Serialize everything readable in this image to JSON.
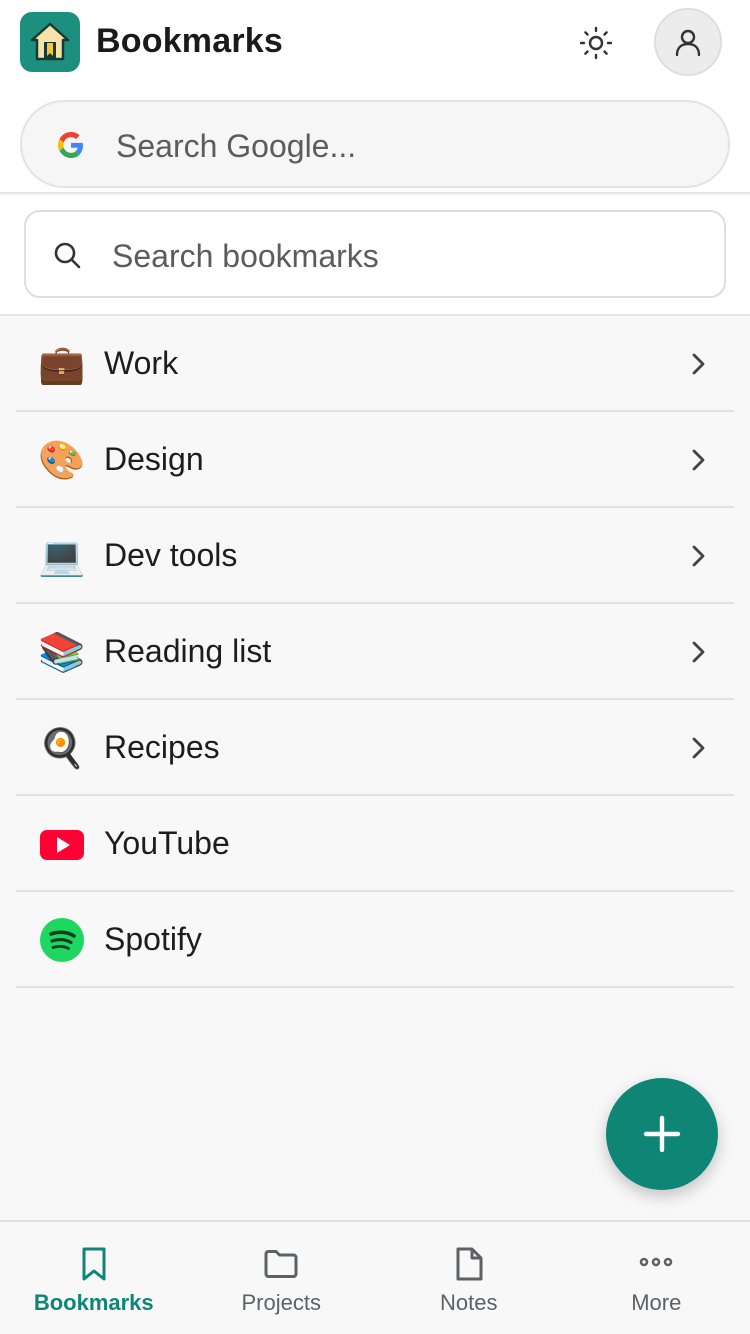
{
  "header": {
    "title": "Bookmarks",
    "logo_icon": "house-bookmark-icon",
    "theme_icon": "sun-icon",
    "avatar_icon": "user-icon"
  },
  "google_search": {
    "placeholder": "Search Google..."
  },
  "bookmark_search": {
    "placeholder": "Search bookmarks"
  },
  "items": [
    {
      "label": "Work",
      "icon": "briefcase-emoji",
      "emoji": "💼",
      "has_chevron": true
    },
    {
      "label": "Design",
      "icon": "palette-emoji",
      "emoji": "🎨",
      "has_chevron": true
    },
    {
      "label": "Dev tools",
      "icon": "laptop-emoji",
      "emoji": "💻",
      "has_chevron": true
    },
    {
      "label": "Reading list",
      "icon": "books-emoji",
      "emoji": "📚",
      "has_chevron": true
    },
    {
      "label": "Recipes",
      "icon": "frying-pan-emoji",
      "emoji": "🍳",
      "has_chevron": true
    },
    {
      "label": "YouTube",
      "icon": "youtube-icon",
      "has_chevron": false
    },
    {
      "label": "Spotify",
      "icon": "spotify-icon",
      "has_chevron": false
    }
  ],
  "fab": {
    "icon": "plus-icon"
  },
  "nav": [
    {
      "label": "Bookmarks",
      "icon": "bookmark-icon",
      "active": true
    },
    {
      "label": "Projects",
      "icon": "folder-icon",
      "active": false
    },
    {
      "label": "Notes",
      "icon": "document-icon",
      "active": false
    },
    {
      "label": "More",
      "icon": "more-dots-icon",
      "active": false
    }
  ],
  "colors": {
    "accent": "#0f8576",
    "logo_bg": "#1d8f7f",
    "youtube_red": "#ff0033",
    "spotify_green": "#1ed760"
  }
}
